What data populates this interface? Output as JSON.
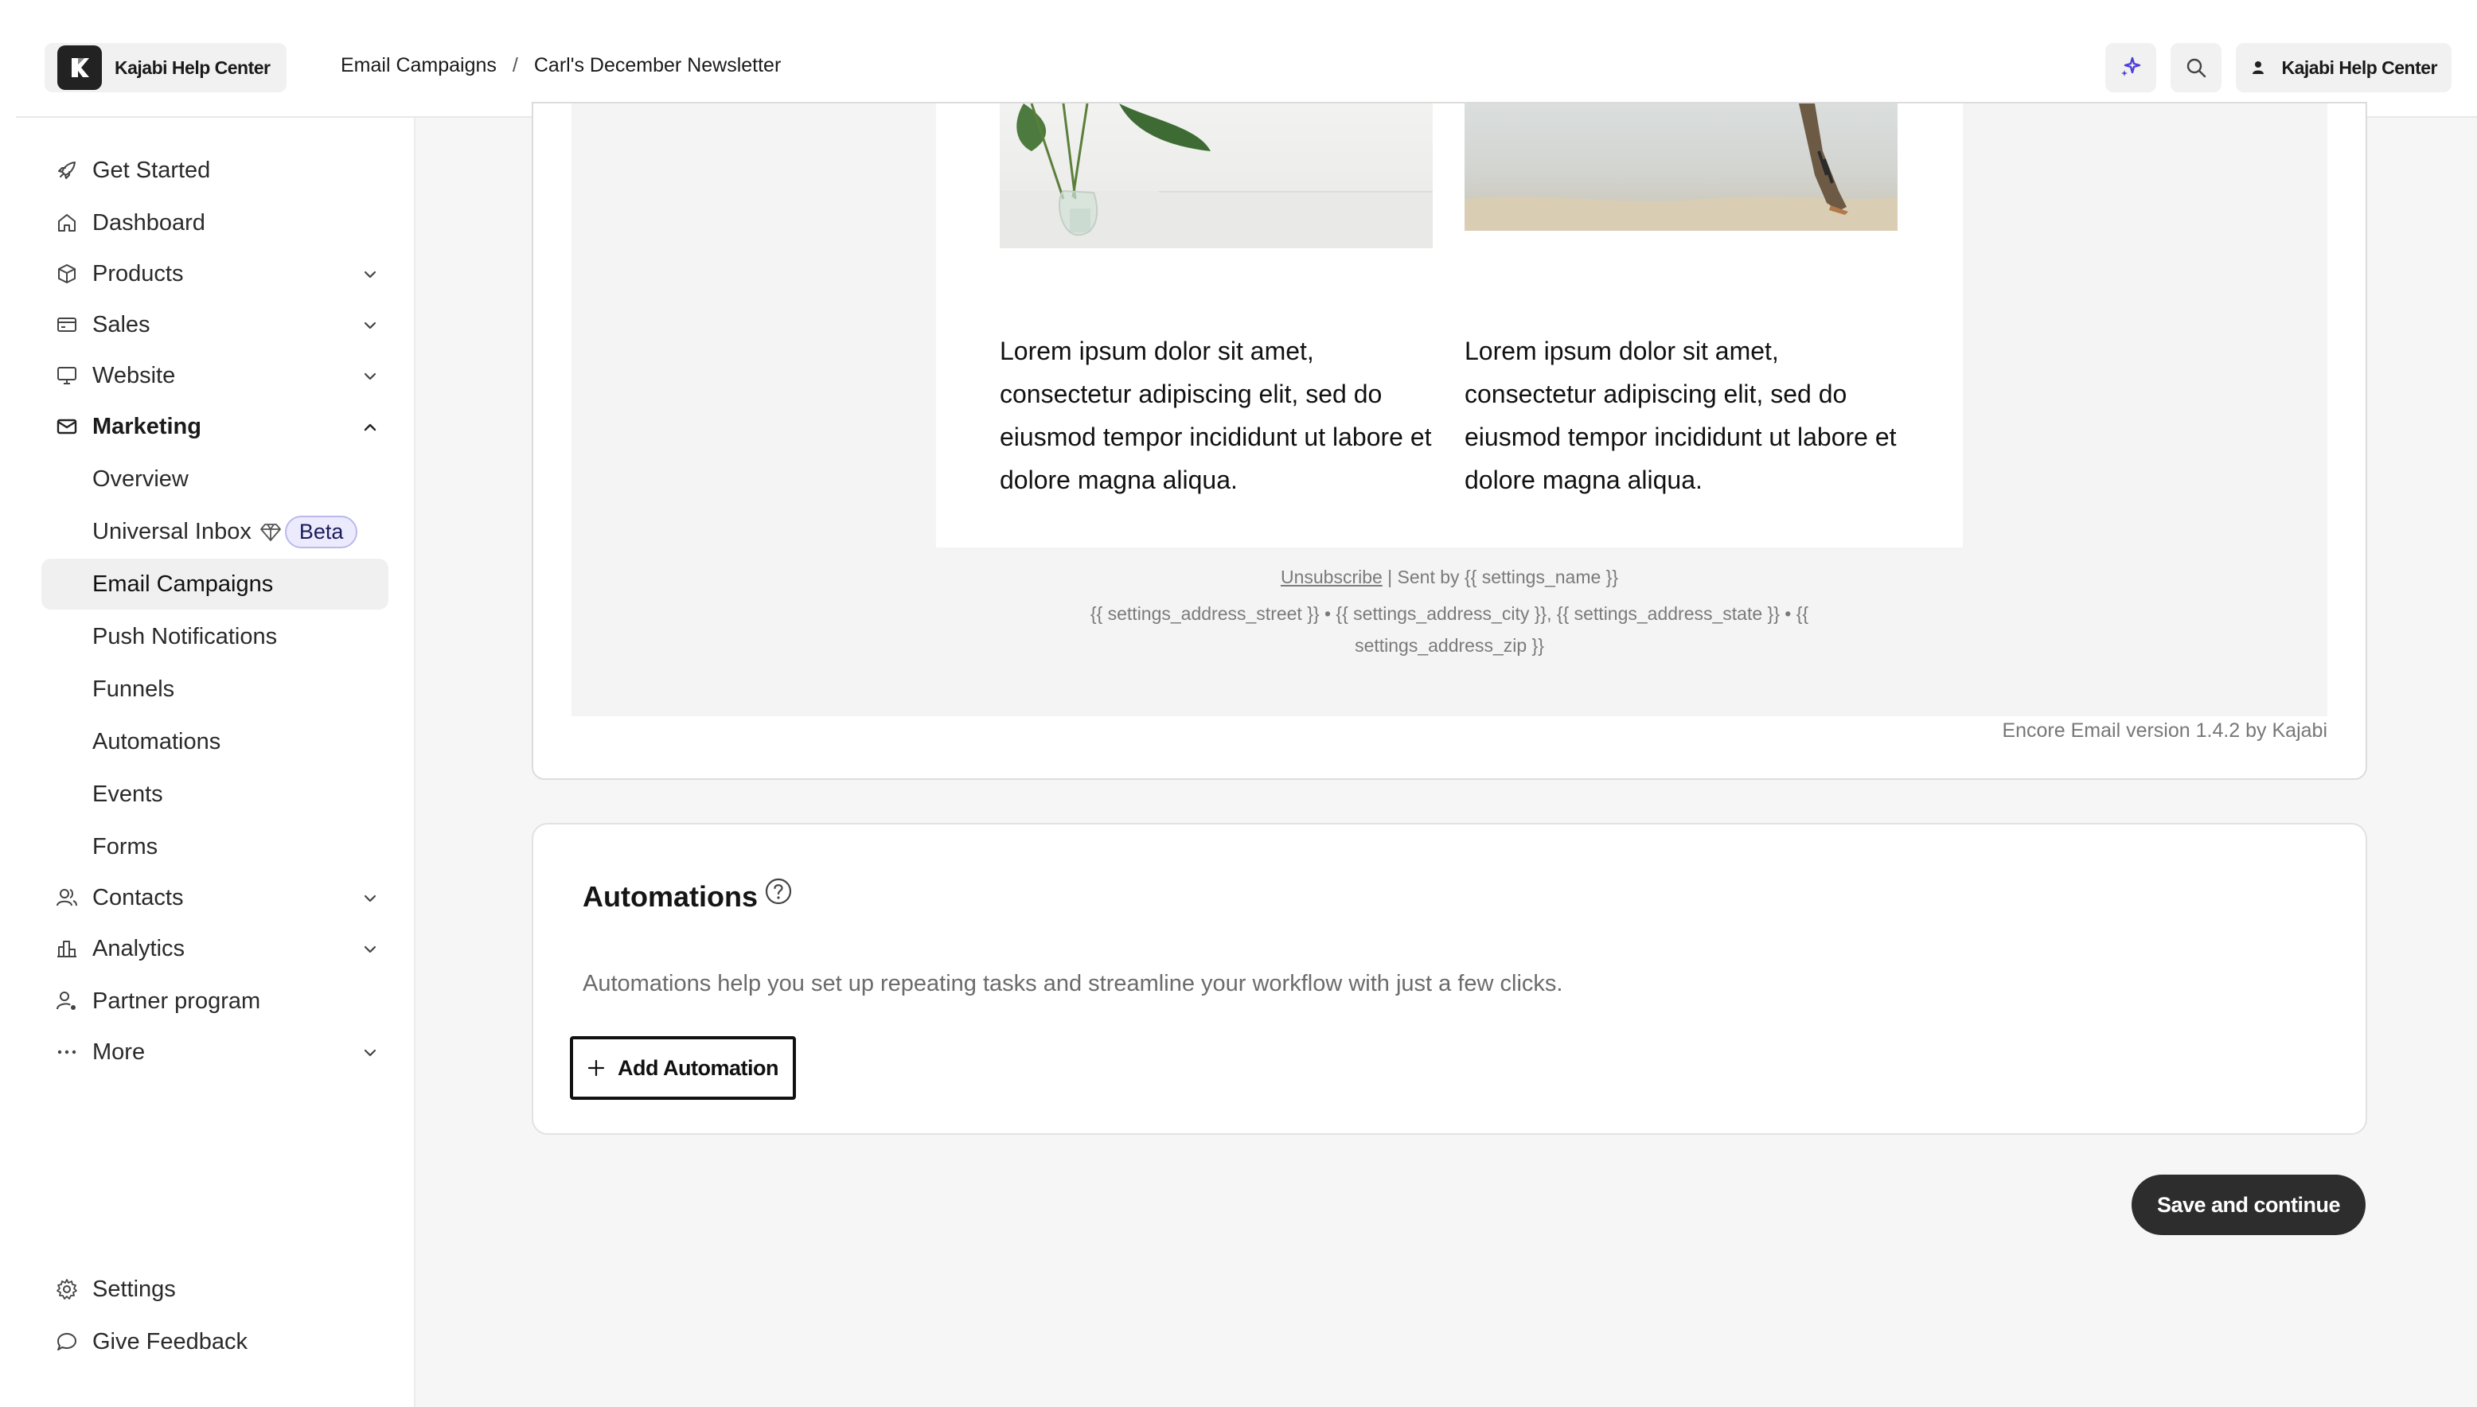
{
  "header": {
    "brand_name": "Kajabi Help Center",
    "breadcrumb": [
      "Email Campaigns",
      "/",
      "Carl's December Newsletter"
    ],
    "account_label": "Kajabi Help Center",
    "ai_icon": "sparkles-icon",
    "search_icon": "search-icon",
    "accent_color": "#4b3fd8"
  },
  "sidebar": {
    "items": [
      {
        "label": "Get Started",
        "icon": "rocket-icon"
      },
      {
        "label": "Dashboard",
        "icon": "home-icon"
      },
      {
        "label": "Products",
        "icon": "box-icon"
      },
      {
        "label": "Sales",
        "icon": "credit-card-icon"
      },
      {
        "label": "Website",
        "icon": "monitor-icon"
      },
      {
        "label": "Marketing",
        "icon": "mail-icon"
      },
      {
        "label": "Overview"
      },
      {
        "label": "Universal Inbox",
        "badge": "Beta"
      },
      {
        "label": "Email Campaigns"
      },
      {
        "label": "Push Notifications"
      },
      {
        "label": "Funnels"
      },
      {
        "label": "Automations"
      },
      {
        "label": "Events"
      },
      {
        "label": "Forms"
      },
      {
        "label": "Contacts",
        "icon": "users-icon"
      },
      {
        "label": "Analytics",
        "icon": "bar-chart-icon"
      },
      {
        "label": "Partner program",
        "icon": "user-plus-icon"
      },
      {
        "label": "More",
        "icon": "more-dots-icon"
      },
      {
        "label": "Settings",
        "icon": "gear-icon"
      },
      {
        "label": "Give Feedback",
        "icon": "chat-bubble-icon"
      }
    ]
  },
  "email_preview": {
    "column_1_text": "Lorem ipsum dolor sit amet, consectetur adipiscing elit, sed do eiusmod tempor incididunt ut labore et dolore magna aliqua.",
    "column_2_text": "Lorem ipsum dolor sit amet, consectetur adipiscing elit, sed do eiusmod tempor incididunt ut labore et dolore magna aliqua.",
    "footer_unsubscribe": "Unsubscribe",
    "footer_sent_by": " | Sent by {{ settings_name }}",
    "footer_address_line1": "{{ settings_address_street }} • {{ settings_address_city }}, {{ settings_address_state }} • {{",
    "footer_address_line2": "settings_address_zip }}",
    "version": "Encore Email version 1.4.2 by Kajabi"
  },
  "automations": {
    "title": "Automations",
    "description": "Automations help you set up repeating tasks and streamline your workflow with just a few clicks.",
    "add_button": "Add Automation"
  },
  "actions": {
    "save_button": "Save and continue"
  }
}
